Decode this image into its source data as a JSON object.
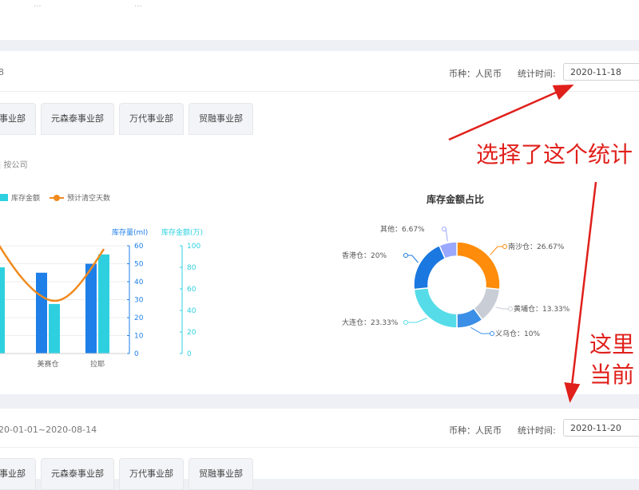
{
  "top": {
    "blur_text_1": "...",
    "blur_text_2": "…"
  },
  "panel1": {
    "header_left": "8",
    "currency": "币种：人民币",
    "stat_time_label": "统计时间:",
    "stat_time_value": "2020-11-18",
    "tabs": [
      "事业部",
      "元森泰事业部",
      "万代事业部",
      "贸融事业部"
    ],
    "filter_label": "| 按公司",
    "legend": {
      "amount": "库存金额",
      "days": "预计清空天数"
    }
  },
  "panel2": {
    "header_left": "20-01-01~2020-08-14",
    "currency": "币种：人民币",
    "stat_time_label": "统计时间:",
    "stat_time_value": "2020-11-20",
    "tabs": [
      "事业部",
      "元森泰事业部",
      "万代事业部",
      "贸融事业部"
    ]
  },
  "annotations": {
    "select_text": "选择了这个统计",
    "here_text": "这里",
    "current_text": "当前",
    "arrow_color": "#e0201b"
  },
  "chart_data": [
    {
      "type": "bar",
      "categories": [
        "",
        "美赛仓",
        "拉耶"
      ],
      "series": [
        {
          "name": "库存量(ml)",
          "axis": "left",
          "values": [
            null,
            45,
            50
          ],
          "color": "#1e7fe8"
        },
        {
          "name": "库存金额(万)",
          "axis": "right",
          "values": [
            80,
            46,
            92
          ],
          "color": "#2ed0e0"
        }
      ],
      "line": {
        "name": "预计清空天数",
        "color": "#f08a1e"
      },
      "y_left": {
        "label": "库存量(ml)",
        "range": [
          0,
          60
        ],
        "ticks": [
          0,
          10,
          20,
          30,
          40,
          50,
          60
        ]
      },
      "y_right": {
        "label": "库存金额(万)",
        "range": [
          0,
          100
        ],
        "ticks": [
          0,
          20,
          40,
          60,
          80,
          100
        ]
      },
      "grid": true
    },
    {
      "type": "pie",
      "title": "库存金额占比",
      "slices": [
        {
          "label": "南沙仓",
          "value": 26.67,
          "text": "南沙仓：26.67%",
          "color": "#ff8c0a"
        },
        {
          "label": "黄埔仓",
          "value": 13.33,
          "text": "黄埔仓：13.33%",
          "color": "#c9ced6"
        },
        {
          "label": "义乌仓",
          "value": 10,
          "text": "义乌仓：10%",
          "color": "#3b8fe6"
        },
        {
          "label": "大连仓",
          "value": 23.33,
          "text": "大连仓：23.33%",
          "color": "#55dce8"
        },
        {
          "label": "香港仓",
          "value": 20,
          "text": "香港仓：20%",
          "color": "#1a78e0"
        },
        {
          "label": "其他",
          "value": 6.67,
          "text": "其他：6.67%",
          "color": "#9aa9ff"
        }
      ]
    }
  ]
}
